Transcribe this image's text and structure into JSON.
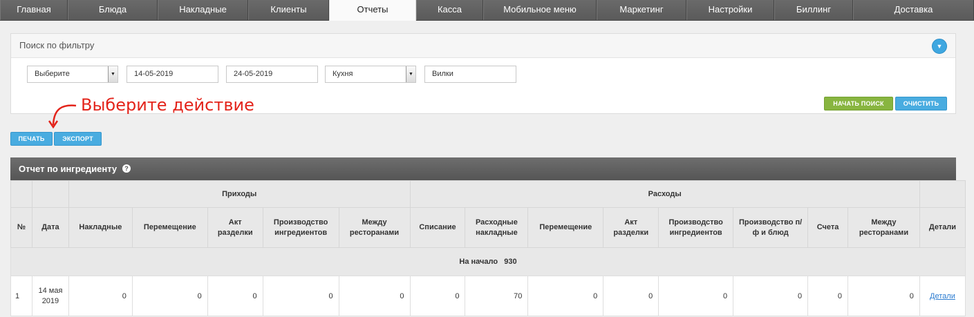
{
  "nav": {
    "tabs": [
      "Главная",
      "Блюда",
      "Накладные",
      "Клиенты",
      "Отчеты",
      "Касса",
      "Мобильное меню",
      "Маркетинг",
      "Настройки",
      "Биллинг",
      "Доставка"
    ],
    "active": "Отчеты"
  },
  "filter": {
    "title": "Поиск по фильтру",
    "select1": "Выберите",
    "date_from": "14-05-2019",
    "date_to": "24-05-2019",
    "store": "Кухня",
    "ingredient": "Вилки",
    "search_button": "НАЧАТЬ ПОИСК",
    "clear_button": "ОЧИСТИТЬ"
  },
  "annotation": "Выберите действие",
  "actions": {
    "print": "ПЕЧАТЬ",
    "export": "ЭКСПОРТ"
  },
  "report": {
    "title": "Отчет по ингредиенту",
    "group_income": "Приходы",
    "group_expense": "Расходы",
    "columns": {
      "num": "№",
      "date": "Дата",
      "inc_invoices": "Накладные",
      "inc_transfer": "Перемещение",
      "inc_cut": "Акт разделки",
      "inc_production": "Производство ингредиентов",
      "inc_between": "Между ресторанами",
      "exp_writeoff": "Списание",
      "exp_invoices": "Расходные накладные",
      "exp_transfer": "Перемещение",
      "exp_cut": "Акт разделки",
      "exp_production": "Производство ингредиентов",
      "exp_prod_dishes": "Производство п/ф и блюд",
      "exp_bills": "Счета",
      "exp_between": "Между ресторанами",
      "details": "Детали"
    },
    "opening_label": "На начало",
    "opening_value": "930",
    "row": {
      "num": "1",
      "date": "14 мая 2019",
      "inc_invoices": "0",
      "inc_transfer": "0",
      "inc_cut": "0",
      "inc_production": "0",
      "inc_between": "0",
      "exp_writeoff": "0",
      "exp_invoices": "70",
      "exp_transfer": "0",
      "exp_cut": "0",
      "exp_production": "0",
      "exp_prod_dishes": "0",
      "exp_bills": "0",
      "exp_between": "0",
      "details": "Детали"
    }
  },
  "colors": {
    "nav_bg": "#5f5f5f",
    "accent_blue": "#49ace0",
    "accent_green": "#88b540",
    "annotation_red": "#e3241b",
    "link": "#2a7bd0"
  }
}
